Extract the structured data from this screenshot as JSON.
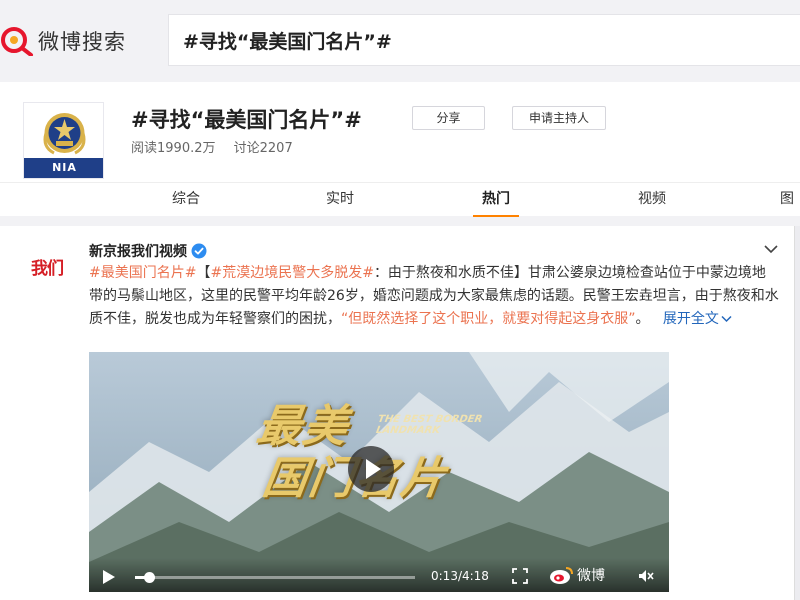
{
  "header": {
    "logo_text": "微博搜索",
    "logo_icon": "weibo-search-icon",
    "search_query": "#寻找“最美国门名片”#"
  },
  "topic": {
    "badge_text": "NIA",
    "title": "#寻找“最美国门名片”#",
    "share_label": "分享",
    "apply_host_label": "申请主持人",
    "reads": "阅读1990.2万",
    "discussions": "讨论2207"
  },
  "tabs": [
    {
      "label": "综合"
    },
    {
      "label": "实时"
    },
    {
      "label": "热门"
    },
    {
      "label": "视频"
    },
    {
      "label": "图"
    }
  ],
  "active_tab": "热门",
  "accent_color": "#ff8200",
  "post": {
    "avatar_text": "我们",
    "author": "新京报我们视频",
    "verified": true,
    "hashtag1": "#最美国门名片#",
    "open_bracket": "【",
    "hashtag2": "#荒漠边境民警大多脱发#",
    "body1": "：由于熬夜和水质不佳】甘肃公婆泉边境检查站位于中蒙边境地带的马鬃山地区，这里的民警平均年龄26岁，婚恋问题成为大家最焦虑的话题。民警王宏垚坦言，由于熬夜和水质不佳，脱发也成为年轻警察们的困扰，",
    "quote": "“但既然选择了这个职业，就要对得起这身衣服”",
    "body2": "。",
    "expand_label": "展开全文",
    "link_color": "#eb7350"
  },
  "video": {
    "title_line1": "最美",
    "title_line2": "国门名片",
    "title_en": "THE BEST BORDER LANDMARK",
    "time": "0:13/4:18",
    "progress": 0.05,
    "watermark": "微博"
  }
}
